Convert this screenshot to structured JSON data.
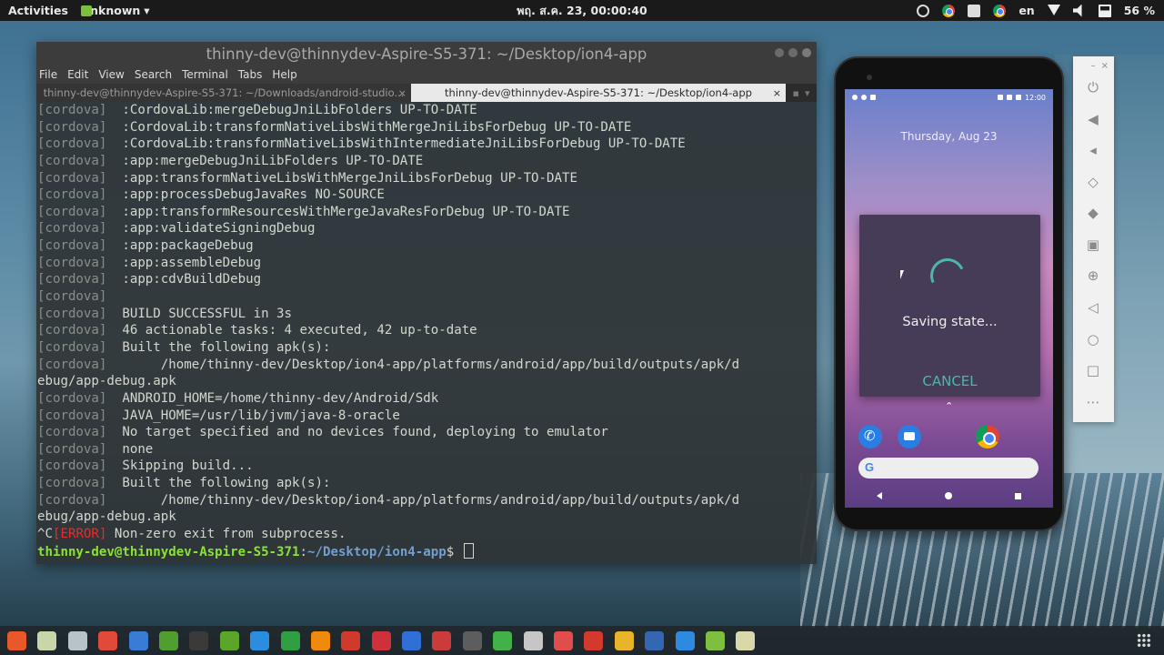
{
  "topbar": {
    "activities": "Activities",
    "app_menu": "Unknown",
    "clock": "พฤ. ส.ค. 23, 00:00:40",
    "language": "en",
    "battery": "56 %"
  },
  "terminal": {
    "title": "thinny-dev@thinnydev-Aspire-S5-371: ~/Desktop/ion4-app",
    "menu": [
      "File",
      "Edit",
      "View",
      "Search",
      "Terminal",
      "Tabs",
      "Help"
    ],
    "tabs": [
      {
        "label": "thinny-dev@thinnydev-Aspire-S5-371: ~/Downloads/android-studio...",
        "active": false
      },
      {
        "label": "thinny-dev@thinnydev-Aspire-S5-371: ~/Desktop/ion4-app",
        "active": true
      }
    ],
    "lines": [
      {
        "p": "[cordova]",
        "t": "  :CordovaLib:mergeDebugJniLibFolders UP-TO-DATE"
      },
      {
        "p": "[cordova]",
        "t": "  :CordovaLib:transformNativeLibsWithMergeJniLibsForDebug UP-TO-DATE"
      },
      {
        "p": "[cordova]",
        "t": "  :CordovaLib:transformNativeLibsWithIntermediateJniLibsForDebug UP-TO-DATE"
      },
      {
        "p": "[cordova]",
        "t": "  :app:mergeDebugJniLibFolders UP-TO-DATE"
      },
      {
        "p": "[cordova]",
        "t": "  :app:transformNativeLibsWithMergeJniLibsForDebug UP-TO-DATE"
      },
      {
        "p": "[cordova]",
        "t": "  :app:processDebugJavaRes NO-SOURCE"
      },
      {
        "p": "[cordova]",
        "t": "  :app:transformResourcesWithMergeJavaResForDebug UP-TO-DATE"
      },
      {
        "p": "[cordova]",
        "t": "  :app:validateSigningDebug"
      },
      {
        "p": "[cordova]",
        "t": "  :app:packageDebug"
      },
      {
        "p": "[cordova]",
        "t": "  :app:assembleDebug"
      },
      {
        "p": "[cordova]",
        "t": "  :app:cdvBuildDebug"
      },
      {
        "p": "[cordova]",
        "t": ""
      },
      {
        "p": "[cordova]",
        "t": "  BUILD SUCCESSFUL in 3s"
      },
      {
        "p": "[cordova]",
        "t": "  46 actionable tasks: 4 executed, 42 up-to-date"
      },
      {
        "p": "[cordova]",
        "t": "  Built the following apk(s):"
      },
      {
        "p": "[cordova]",
        "t": "       /home/thinny-dev/Desktop/ion4-app/platforms/android/app/build/outputs/apk/d"
      },
      {
        "p": "",
        "t": "ebug/app-debug.apk"
      },
      {
        "p": "[cordova]",
        "t": "  ANDROID_HOME=/home/thinny-dev/Android/Sdk"
      },
      {
        "p": "[cordova]",
        "t": "  JAVA_HOME=/usr/lib/jvm/java-8-oracle"
      },
      {
        "p": "[cordova]",
        "t": "  No target specified and no devices found, deploying to emulator"
      },
      {
        "p": "[cordova]",
        "t": "  none"
      },
      {
        "p": "[cordova]",
        "t": "  Skipping build..."
      },
      {
        "p": "[cordova]",
        "t": "  Built the following apk(s):"
      },
      {
        "p": "[cordova]",
        "t": "       /home/thinny-dev/Desktop/ion4-app/platforms/android/app/build/outputs/apk/d"
      },
      {
        "p": "",
        "t": "ebug/app-debug.apk"
      }
    ],
    "error_line": {
      "pre": "^C",
      "tag": "[ERROR]",
      "msg": " Non-zero exit from subprocess."
    },
    "prompt": {
      "user": "thinny-dev@thinnydev-Aspire-S5-371",
      "sep": ":",
      "path": "~/Desktop/ion4-app",
      "symbol": "$ "
    }
  },
  "phone": {
    "status_time": "12:00",
    "date": "Thursday, Aug 23",
    "dialog_message": "Saving state...",
    "dialog_cancel": "CANCEL",
    "search_glyph": "G"
  },
  "emulator_toolbar": {
    "icons": [
      "power-icon",
      "volume-up-icon",
      "volume-down-icon",
      "rotate-left-icon",
      "rotate-right-icon",
      "camera-icon",
      "zoom-icon",
      "back-icon",
      "home-icon",
      "overview-icon",
      "more-icon"
    ]
  },
  "dock": {
    "icon_colors": [
      "#e8582a",
      "#c9d6a8",
      "#b8c3c8",
      "#e14a3b",
      "#3a7bd5",
      "#4f9e2f",
      "#3a3a3a",
      "#5ca52b",
      "#2b8de0",
      "#2ea043",
      "#f08a0a",
      "#d03a2d",
      "#d0303a",
      "#2f6fd6",
      "#cc3b3b",
      "#5d5d5d",
      "#43b14a",
      "#c6c6c6",
      "#e14c4c",
      "#d4392e",
      "#e8b42a",
      "#3467b1",
      "#2c8ae0",
      "#7fbf3f",
      "#d8d8a8"
    ]
  }
}
